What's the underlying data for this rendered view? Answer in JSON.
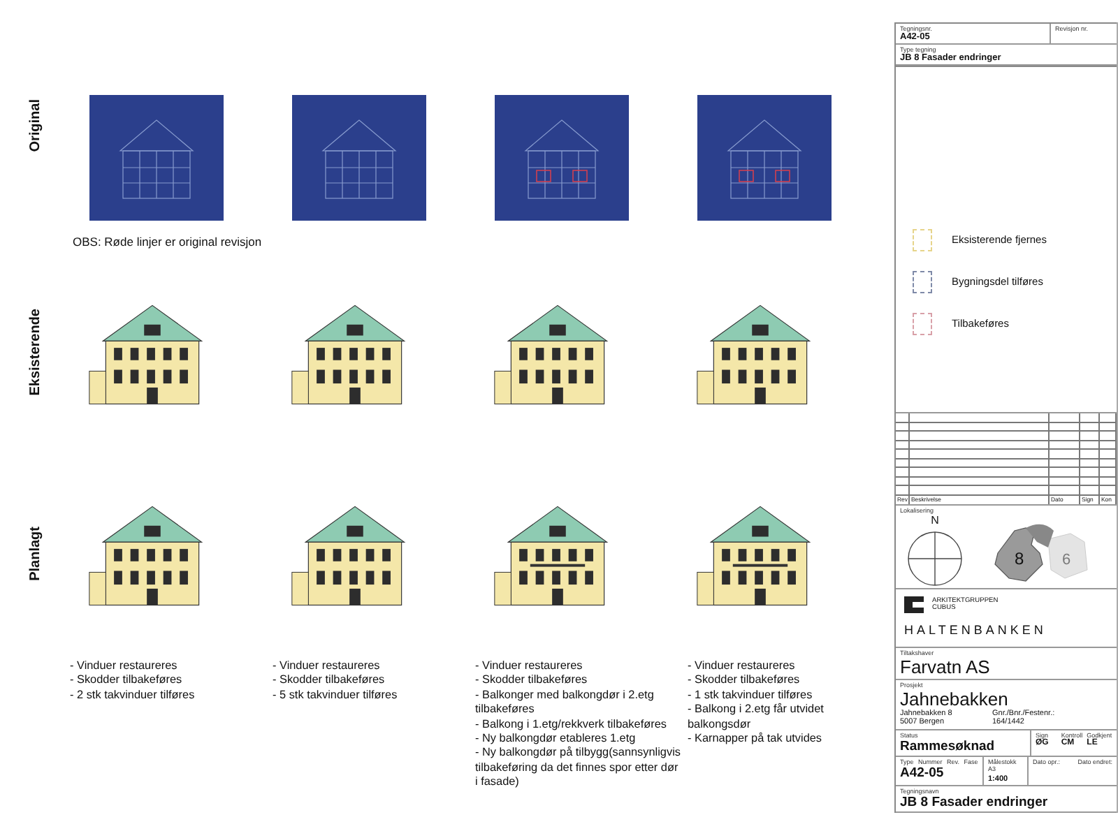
{
  "rows": [
    {
      "label": "Original",
      "kind": "scan",
      "note": "OBS: Røde linjer er original revisjon"
    },
    {
      "label": "Eksisterende",
      "kind": "drawing"
    },
    {
      "label": "Planlagt",
      "kind": "drawing"
    }
  ],
  "notes": [
    [
      "- Vinduer restaureres",
      "- Skodder tilbakeføres",
      "- 2 stk takvinduer tilføres"
    ],
    [
      "- Vinduer restaureres",
      "- Skodder tilbakeføres",
      "- 5 stk takvinduer tilføres"
    ],
    [
      "- Vinduer restaureres",
      "- Skodder tilbakeføres",
      "- Balkonger med balkongdør i 2.etg tilbakeføres",
      "- Balkong i 1.etg/rekkverk tilbakeføres",
      "- Ny balkongdør etableres 1.etg",
      "- Ny balkongdør på tilbygg(sannsynligvis tilbakeføring da det finnes spor etter dør i fasade)"
    ],
    [
      "- Vinduer restaureres",
      "- Skodder tilbakeføres",
      "- 1 stk takvinduer tilføres",
      "- Balkong i 2.etg får utvidet balkongsdør",
      "- Karnapper på tak utvides"
    ]
  ],
  "title_block": {
    "drawing_number_label": "Tegningsnr.",
    "drawing_number": "A42-05",
    "revision_label": "Revisjon nr.",
    "type_label": "Type tegning",
    "type": "JB 8 Fasader endringer",
    "legend": [
      {
        "label": "Eksisterende fjernes",
        "color": "#e6d48a"
      },
      {
        "label": "Bygningsdel tilføres",
        "color": "#7f8aa8"
      },
      {
        "label": "Tilbakeføres",
        "color": "#d8a0a8"
      }
    ],
    "revision_columns": [
      "Rev",
      "Beskrivelse",
      "Dato",
      "Sign",
      "Kon"
    ],
    "location_label": "Lokalisering",
    "north": "N",
    "buildings": [
      "8",
      "6"
    ],
    "firm": [
      "ARKITEKTGRUPPEN",
      "CUBUS"
    ],
    "brand": "HALTENBANKEN",
    "client_label": "Tiltakshaver",
    "client": "Farvatn AS",
    "project_label": "Prosjekt",
    "project": "Jahnebakken",
    "address": [
      "Jahnebakken 8",
      "5007 Bergen"
    ],
    "parcel_label": "Gnr./Bnr./Festenr.:",
    "parcel": "164/1442",
    "status_label": "Status",
    "status": "Rammesøknad",
    "sign_labels": [
      "Sign",
      "Kontroll",
      "Godkjent"
    ],
    "signs": [
      "ØG",
      "CM",
      "LE"
    ],
    "number_labels": [
      "Type",
      "Nummer",
      "Rev.",
      "Fase"
    ],
    "number": "A42-05",
    "scale_label": "Målestokk A3",
    "scale": "1:400",
    "date_labels": [
      "Dato opr.:",
      "Dato endret:"
    ],
    "name_label": "Tegningsnavn",
    "name": "JB 8 Fasader endringer"
  }
}
